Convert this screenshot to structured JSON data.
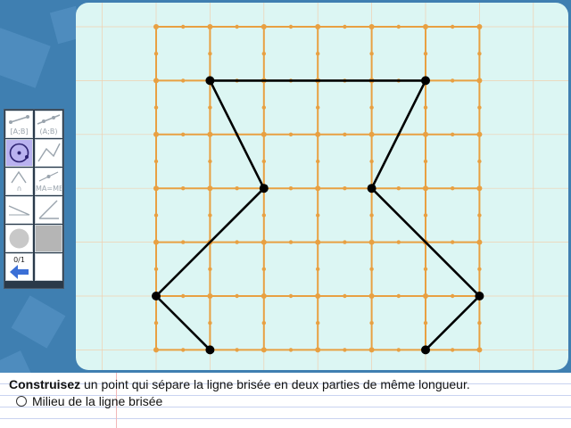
{
  "instructions": {
    "verb": "Construisez",
    "rest": " un point qui sépare la ligne brisée en deux parties de même longueur.",
    "choices": [
      {
        "label": "Milieu de la ligne brisée",
        "selected": false
      }
    ]
  },
  "toolbox": {
    "tools": [
      {
        "id": "segment",
        "label": "[A;B]",
        "icon": "segment-tool-icon",
        "active": false
      },
      {
        "id": "segment-alt",
        "label": "(A;B)",
        "icon": "line-tool-icon",
        "active": false
      },
      {
        "id": "circle",
        "label": "",
        "icon": "circle-tool-icon",
        "active": true
      },
      {
        "id": "broken-line",
        "label": "",
        "icon": "broken-line-tool-icon",
        "active": false
      },
      {
        "id": "compass",
        "label": "∩",
        "icon": "compass-tool-icon",
        "active": false
      },
      {
        "id": "length",
        "label": "MA=MB",
        "icon": "equal-length-tool-icon",
        "active": false
      },
      {
        "id": "ruler",
        "label": "",
        "icon": "ruler-tool-icon",
        "active": false
      },
      {
        "id": "protractor",
        "label": "",
        "icon": "angle-tool-icon",
        "active": false
      },
      {
        "id": "point",
        "label": "",
        "icon": "point-tool-icon",
        "active": false
      },
      {
        "id": "fill",
        "label": "",
        "icon": "fill-tool-icon",
        "active": false
      },
      {
        "id": "undo",
        "label": "0/1",
        "icon": "undo-arrow-icon",
        "active": false
      }
    ]
  },
  "figure": {
    "grid": {
      "cols": 6,
      "rows": 6,
      "color": "#e8a042"
    },
    "broken_line_vertices": [
      [
        1,
        1
      ],
      [
        5,
        1
      ],
      [
        4,
        3
      ],
      [
        6,
        5
      ],
      [
        5,
        6
      ],
      [
        1,
        6
      ],
      [
        0,
        5
      ],
      [
        2,
        3
      ],
      [
        1,
        1
      ]
    ],
    "polyline_points": [
      [
        1,
        6
      ],
      [
        0,
        5
      ],
      [
        2,
        3
      ],
      [
        1,
        1
      ],
      [
        5,
        1
      ],
      [
        4,
        3
      ],
      [
        6,
        5
      ],
      [
        5,
        6
      ]
    ],
    "line_color": "#000000"
  },
  "colors": {
    "background": "#3f7fb1",
    "canvas": "#dcf6f3",
    "grid": "#e8a042",
    "tool_active": "#b9b2f0"
  }
}
